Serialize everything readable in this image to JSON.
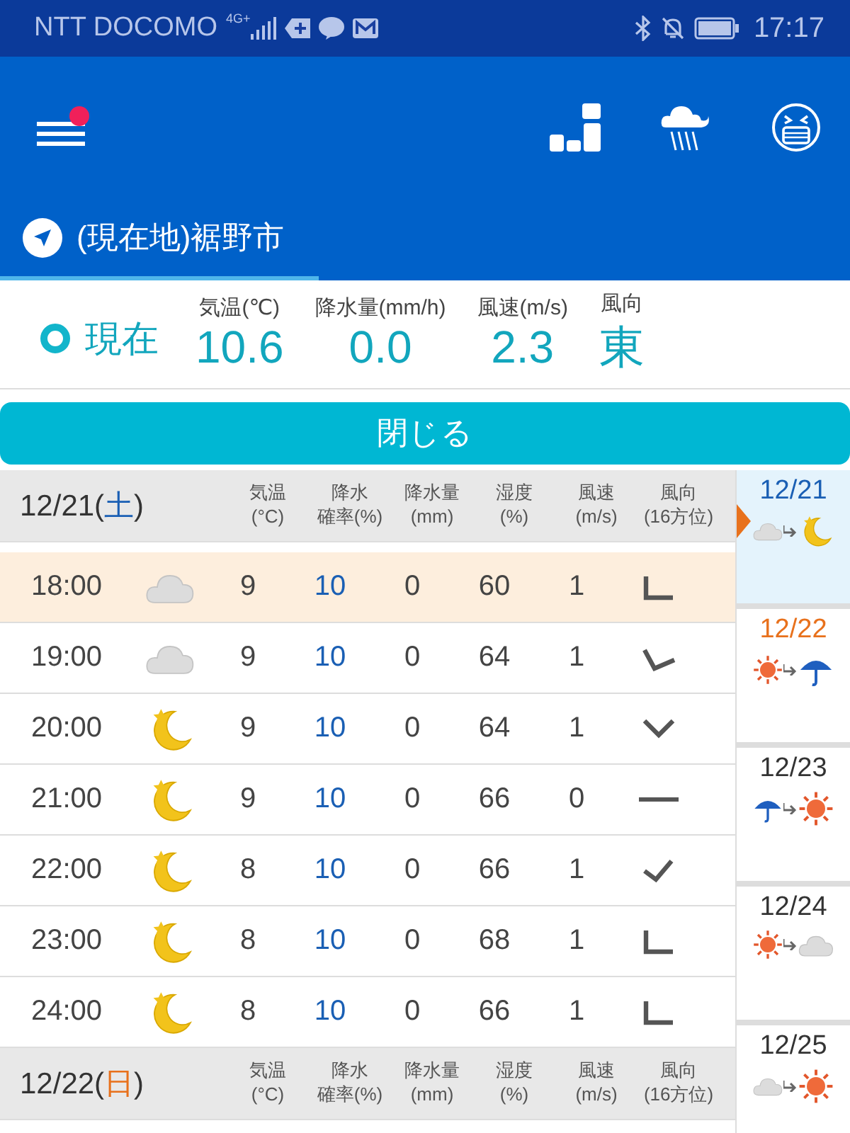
{
  "status_bar": {
    "carrier": "NTT DOCOMO",
    "network": "4G+",
    "time": "17:17"
  },
  "location": {
    "name": "(現在地)裾野市"
  },
  "current": {
    "label": "現在",
    "values": [
      {
        "label": "気温(℃)",
        "value": "10.6"
      },
      {
        "label": "降水量(mm/h)",
        "value": "0.0"
      },
      {
        "label": "風速(m/s)",
        "value": "2.3"
      },
      {
        "label": "風向",
        "value": "東"
      }
    ]
  },
  "close_button": "閉じる",
  "days": [
    {
      "date_parts": [
        "12/21(",
        "土",
        ")"
      ],
      "color": "#1a5fb4",
      "columns": [
        {
          "line1": "気温",
          "line2": "(°C)"
        },
        {
          "line1": "降水",
          "line2": "確率(%)"
        },
        {
          "line1": "降水量",
          "line2": "(mm)"
        },
        {
          "line1": "湿度",
          "line2": "(%)"
        },
        {
          "line1": "風速",
          "line2": "(m/s)"
        },
        {
          "line1": "風向",
          "line2": "(16方位)"
        }
      ],
      "rows": [
        {
          "time": "18:00",
          "weather": {
            "kind": "cloud"
          },
          "temp": "9",
          "prob": "10",
          "rain": "0",
          "humidity": "60",
          "wind_speed": "1",
          "wind_direction": {
            "kind": "corner"
          },
          "selected": true
        },
        {
          "time": "19:00",
          "weather": {
            "kind": "cloud"
          },
          "temp": "9",
          "prob": "10",
          "rain": "0",
          "humidity": "64",
          "wind_speed": "1",
          "wind_direction": {
            "kind": "tilt"
          },
          "selected": false
        },
        {
          "time": "20:00",
          "weather": {
            "kind": "moon"
          },
          "temp": "9",
          "prob": "10",
          "rain": "0",
          "humidity": "64",
          "wind_speed": "1",
          "wind_direction": {
            "kind": "vee"
          },
          "selected": false
        },
        {
          "time": "21:00",
          "weather": {
            "kind": "moon"
          },
          "temp": "9",
          "prob": "10",
          "rain": "0",
          "humidity": "66",
          "wind_speed": "0",
          "wind_direction": {
            "kind": "dash"
          },
          "selected": false
        },
        {
          "time": "22:00",
          "weather": {
            "kind": "moon"
          },
          "temp": "8",
          "prob": "10",
          "rain": "0",
          "humidity": "66",
          "wind_speed": "1",
          "wind_direction": {
            "kind": "tick"
          },
          "selected": false
        },
        {
          "time": "23:00",
          "weather": {
            "kind": "moon"
          },
          "temp": "8",
          "prob": "10",
          "rain": "0",
          "humidity": "68",
          "wind_speed": "1",
          "wind_direction": {
            "kind": "corner"
          },
          "selected": false
        },
        {
          "time": "24:00",
          "weather": {
            "kind": "moon"
          },
          "temp": "8",
          "prob": "10",
          "rain": "0",
          "humidity": "66",
          "wind_speed": "1",
          "wind_direction": {
            "kind": "corner"
          },
          "selected": false
        }
      ]
    },
    {
      "date_parts": [
        "12/22(",
        "日",
        ")"
      ],
      "color": "#e8711c",
      "columns": [
        {
          "line1": "気温",
          "line2": "(°C)"
        },
        {
          "line1": "降水",
          "line2": "確率(%)"
        },
        {
          "line1": "降水量",
          "line2": "(mm)"
        },
        {
          "line1": "湿度",
          "line2": "(%)"
        },
        {
          "line1": "風速",
          "line2": "(m/s)"
        },
        {
          "line1": "風向",
          "line2": "(16方位)"
        }
      ]
    }
  ],
  "day_list": [
    {
      "date": "12/21",
      "color": "#1a5fb4",
      "icons": [
        {
          "kind": "cloud"
        },
        {
          "kind": "moon"
        }
      ],
      "selected": true
    },
    {
      "date": "12/22",
      "color": "#e8711c",
      "icons": [
        {
          "kind": "sun"
        },
        {
          "kind": "umbrella"
        }
      ],
      "selected": false
    },
    {
      "date": "12/23",
      "color": "#333333",
      "icons": [
        {
          "kind": "umbrella"
        },
        {
          "kind": "sun"
        }
      ],
      "selected": false
    },
    {
      "date": "12/24",
      "color": "#333333",
      "icons": [
        {
          "kind": "sun"
        },
        {
          "kind": "cloud"
        }
      ],
      "selected": false
    },
    {
      "date": "12/25",
      "color": "#333333",
      "icons": [
        {
          "kind": "cloud"
        },
        {
          "kind": "sun"
        }
      ],
      "selected": false
    }
  ]
}
